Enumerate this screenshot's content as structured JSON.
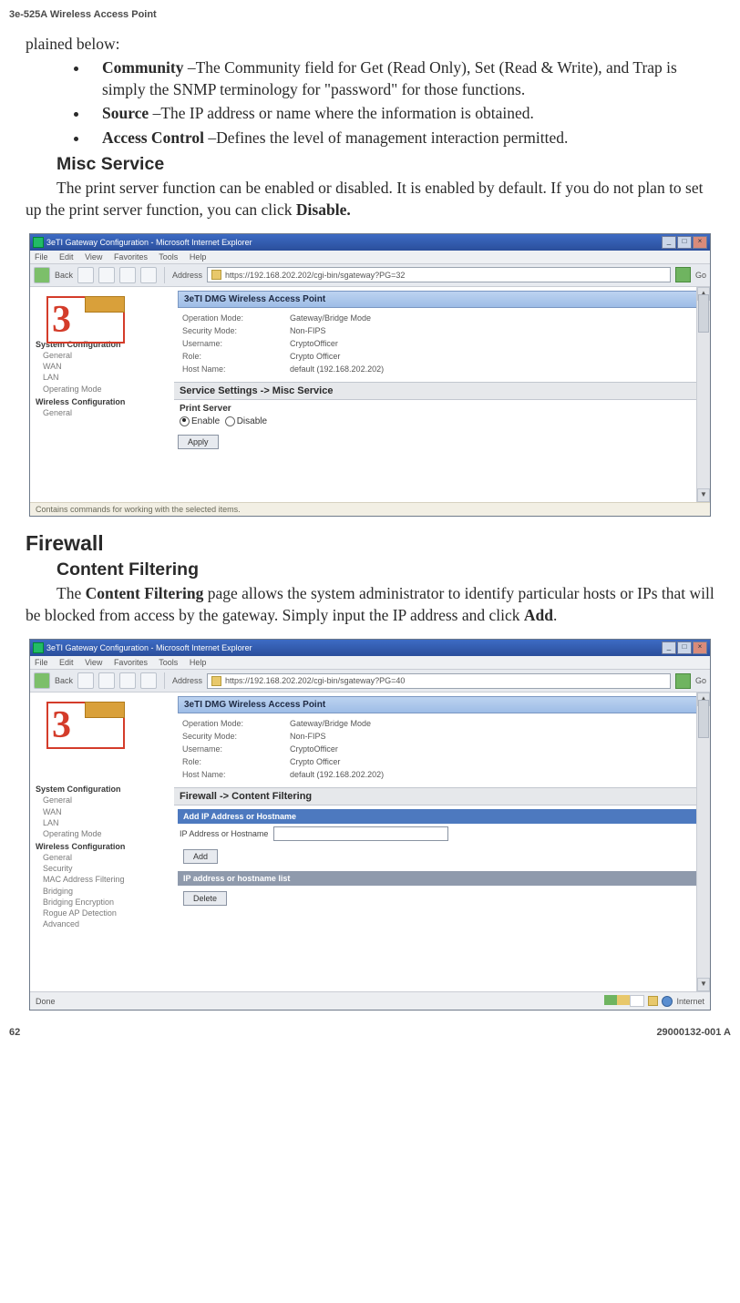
{
  "header": {
    "model": "3e-525A Wireless Access Point"
  },
  "intro_line": "plained below:",
  "bullets": [
    {
      "term": "Community",
      "text": " –The Community field for Get (Read Only), Set (Read & Write), and Trap is simply the SNMP terminology for \"password\" for those functions."
    },
    {
      "term": "Source",
      "text": " –The IP address or name where the information is obtained."
    },
    {
      "term": "Access Control",
      "text": " –Defines the level of management interaction permitted."
    }
  ],
  "misc": {
    "heading": "Misc Service",
    "p1a": "The print server function can be enabled or disabled. It is enabled by default. If you do not plan to set up the print server function, you can click ",
    "p1b": "Disable."
  },
  "browser1": {
    "title": "3eTI Gateway Configuration - Microsoft Internet Explorer",
    "menu": {
      "file": "File",
      "edit": "Edit",
      "view": "View",
      "fav": "Favorites",
      "tools": "Tools",
      "help": "Help"
    },
    "back": "Back",
    "address_label": "Address",
    "url": "https://192.168.202.202/cgi-bin/sgateway?PG=32",
    "go": "Go",
    "tab_header": "3eTI DMG Wireless Access Point",
    "info": {
      "k1": "Operation Mode:",
      "v1": "Gateway/Bridge Mode",
      "k2": "Security Mode:",
      "v2": "Non-FIPS",
      "k3": "Username:",
      "v3": "CryptoOfficer",
      "k4": "Role:",
      "v4": "Crypto Officer",
      "k5": "Host Name:",
      "v5": "default (192.168.202.202)"
    },
    "section": "Service Settings -> Misc Service",
    "print_label": "Print Server",
    "enable": "Enable",
    "disable": "Disable",
    "apply": "Apply",
    "hint": "Contains commands for working with the selected items.",
    "side": {
      "g1": "System Configuration",
      "i1": "General",
      "i2": "WAN",
      "i3": "LAN",
      "i4": "Operating Mode",
      "g2": "Wireless Configuration",
      "i5": "General"
    }
  },
  "firewall": {
    "heading": "Firewall",
    "sub": "Content Filtering",
    "p_a": "The ",
    "p_b": "Content Filtering",
    "p_c": " page allows the system administrator to identify particular hosts or IPs that will be blocked from access by the gateway. Simply input the IP address and click ",
    "p_d": "Add",
    "p_e": "."
  },
  "browser2": {
    "title": "3eTI Gateway Configuration - Microsoft Internet Explorer",
    "url": "https://192.168.202.202/cgi-bin/sgateway?PG=40",
    "tab_header": "3eTI DMG Wireless Access Point",
    "info": {
      "k1": "Operation Mode:",
      "v1": "Gateway/Bridge Mode",
      "k2": "Security Mode:",
      "v2": "Non-FIPS",
      "k3": "Username:",
      "v3": "CryptoOfficer",
      "k4": "Role:",
      "v4": "Crypto Officer",
      "k5": "Host Name:",
      "v5": "default (192.168.202.202)"
    },
    "section": "Firewall -> Content Filtering",
    "bar1": "Add IP Address or Hostname",
    "rowlabel": "IP Address or Hostname",
    "add": "Add",
    "bar2": "IP address or hostname list",
    "delete": "Delete",
    "side": {
      "g1": "System Configuration",
      "i1": "General",
      "i2": "WAN",
      "i3": "LAN",
      "i4": "Operating Mode",
      "g2": "Wireless Configuration",
      "i5": "General",
      "i6": "Security",
      "i7": "MAC Address Filtering",
      "i8": "Bridging",
      "i9": "Bridging Encryption",
      "i10": "Rogue AP Detection",
      "i11": "Advanced"
    },
    "status_done": "Done",
    "status_net": "Internet"
  },
  "footer": {
    "page": "62",
    "doc": "29000132-001 A"
  }
}
